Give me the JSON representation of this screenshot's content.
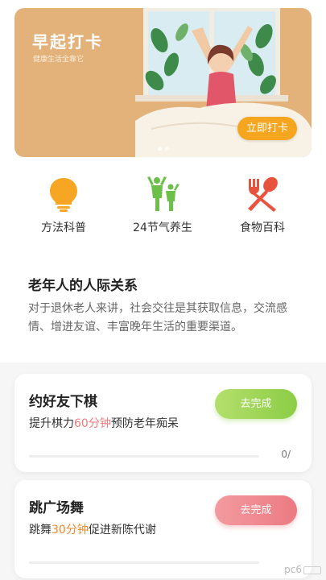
{
  "banner": {
    "title": "早起打卡",
    "subtitle": "健康生活全靠它",
    "cta_label": "立即打卡",
    "slides": 2,
    "active_slide": 0
  },
  "categories": [
    {
      "label": "方法科普",
      "icon": "lightbulb-icon",
      "color": "#f6a623"
    },
    {
      "label": "24节气养生",
      "icon": "people-icon",
      "color": "#6cc04a"
    },
    {
      "label": "食物百科",
      "icon": "utensils-icon",
      "color": "#e8533f"
    }
  ],
  "article": {
    "title": "老年人的人际关系",
    "description": "对于退休老人来讲，社会交往是其获取信息，交流感情、增进友谊、丰富晚年生活的重要渠道。"
  },
  "tasks": [
    {
      "title": "约好友下棋",
      "desc_before": "提升棋力",
      "desc_highlight": "60分钟",
      "desc_after": "预防老年痴呆",
      "button_label": "去完成",
      "progress_text": "0/",
      "progress": 0
    },
    {
      "title": "跳广场舞",
      "desc_before": "跳舞",
      "desc_highlight": "30分钟",
      "desc_after": "促进新陈代谢",
      "button_label": "去完成",
      "progress_text": "",
      "progress": 0
    }
  ],
  "watermark": "pc6",
  "colors": {
    "banner_bg": "#e2b27a",
    "cta": "#f6a51f",
    "green_button": "#8ccd45",
    "red_button": "#ec7a82",
    "highlight_red": "#f07a7a",
    "highlight_orange": "#f08a28"
  }
}
